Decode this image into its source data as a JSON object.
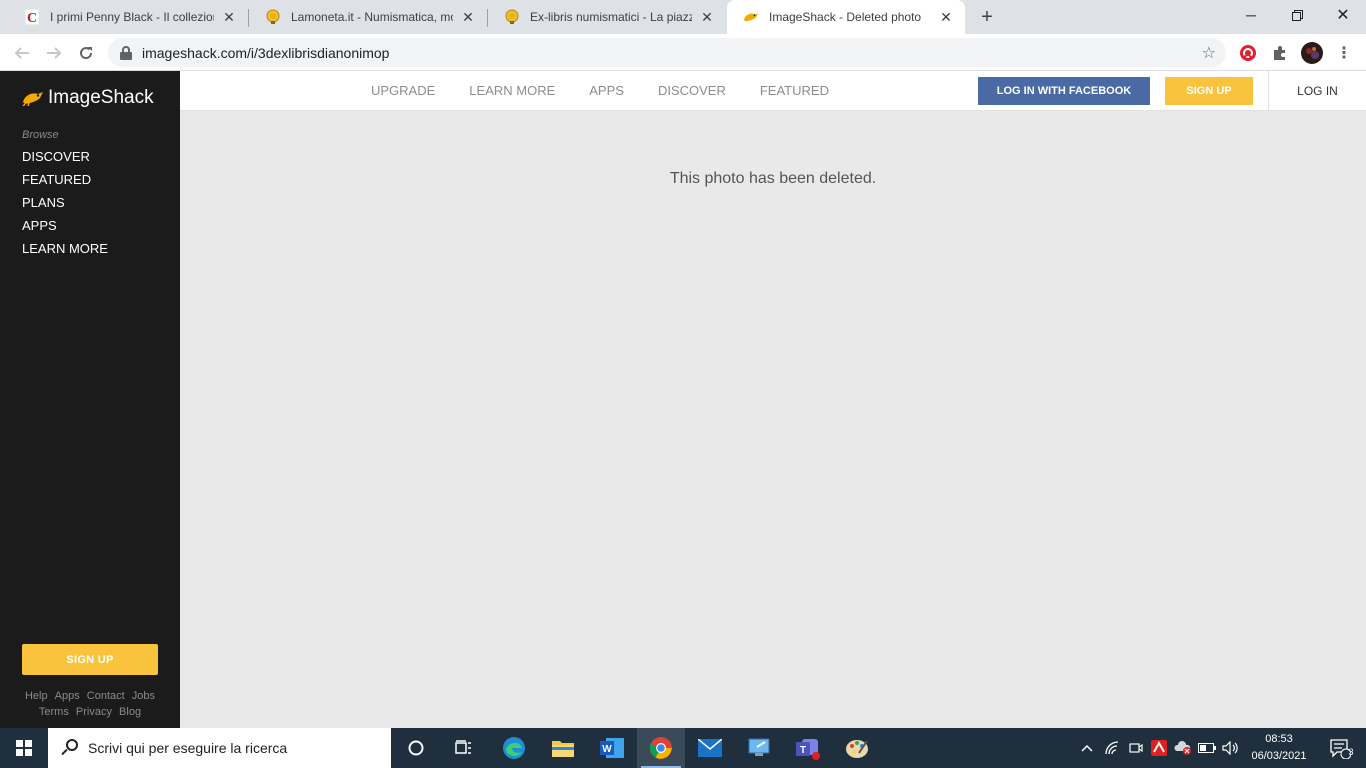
{
  "browser": {
    "tabs": [
      {
        "title": "I primi Penny Black - Il collezionis",
        "favicon": "c-red-icon",
        "active": false
      },
      {
        "title": "Lamoneta.it - Numismatica, mone",
        "favicon": "coin-icon",
        "active": false
      },
      {
        "title": "Ex-libris numismatici - La piazzett",
        "favicon": "coin-icon",
        "active": false
      },
      {
        "title": "ImageShack - Deleted photo",
        "favicon": "frog-icon",
        "active": true
      }
    ],
    "url": "imageshack.com/i/3dexlibrisdianonimop"
  },
  "site": {
    "logo_text": "ImageShack",
    "browse_label": "Browse",
    "sidebar_nav": [
      "DISCOVER",
      "FEATURED",
      "PLANS",
      "APPS",
      "LEARN MORE"
    ],
    "sidebar_signup": "SIGN UP",
    "footer_row1": [
      "Help",
      "Apps",
      "Contact",
      "Jobs"
    ],
    "footer_row2": [
      "Terms",
      "Privacy",
      "Blog"
    ],
    "top_nav": [
      "UPGRADE",
      "LEARN MORE",
      "APPS",
      "DISCOVER",
      "FEATURED"
    ],
    "facebook_button": "LOG IN WITH FACEBOOK",
    "signup_button": "SIGN UP",
    "login_button": "LOG IN",
    "message": "This photo has been deleted.",
    "colors": {
      "accent": "#f9c33d",
      "facebook": "#4a6aa6",
      "sidebar": "#1b1b1b"
    }
  },
  "taskbar": {
    "search_placeholder": "Scrivi qui per eseguire la ricerca",
    "time": "08:53",
    "date": "06/03/2021",
    "notification_count": "3"
  }
}
